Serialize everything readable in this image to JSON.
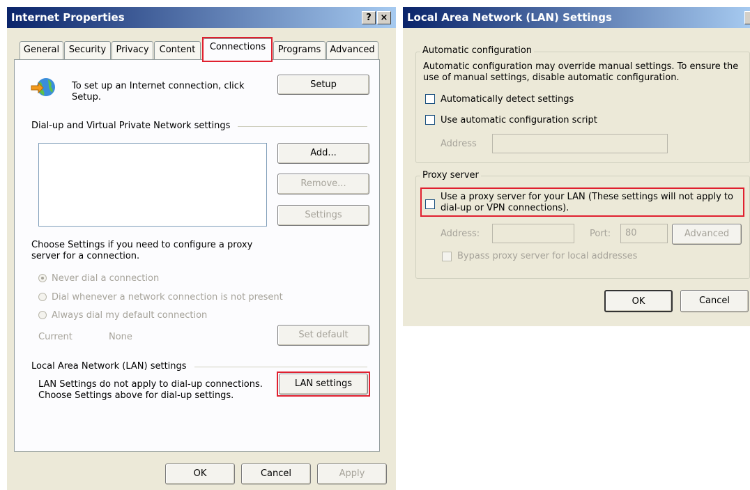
{
  "ie": {
    "title": "Internet Properties",
    "help_btn": "?",
    "close_btn": "×",
    "tabs": [
      "General",
      "Security",
      "Privacy",
      "Content",
      "Connections",
      "Programs",
      "Advanced"
    ],
    "setup_text": "To set up an Internet connection, click Setup.",
    "setup_btn": "Setup",
    "dialup_header": "Dial-up and Virtual Private Network settings",
    "add_btn": "Add...",
    "remove_btn": "Remove...",
    "settings_btn": "Settings",
    "proxy_text": "Choose Settings if you need to configure a proxy server for a connection.",
    "radios": [
      "Never dial a connection",
      "Dial whenever a network connection is not present",
      "Always dial my default connection"
    ],
    "current_label": "Current",
    "current_value": "None",
    "setdefault_btn": "Set default",
    "lan_header": "Local Area Network (LAN) settings",
    "lan_text": "LAN Settings do not apply to dial-up connections. Choose Settings above for dial-up settings.",
    "lan_btn": "LAN settings",
    "ok_btn": "OK",
    "cancel_btn": "Cancel",
    "apply_btn": "Apply"
  },
  "lan": {
    "title": "Local Area Network (LAN) Settings",
    "auto_group": "Automatic configuration",
    "auto_desc": "Automatic configuration may override manual settings.  To ensure the use of manual settings, disable automatic configuration.",
    "auto_detect": "Automatically detect settings",
    "auto_script": "Use automatic configuration script",
    "address_label": "Address",
    "proxy_group": "Proxy server",
    "use_proxy": "Use a proxy server for your LAN (These settings will not apply to dial-up or VPN connections).",
    "proxy_address_label": "Address:",
    "port_label": "Port:",
    "port_value": "80",
    "advanced_btn": "Advanced",
    "bypass": "Bypass proxy server for local addresses",
    "ok_btn": "OK",
    "cancel_btn": "Cancel"
  }
}
